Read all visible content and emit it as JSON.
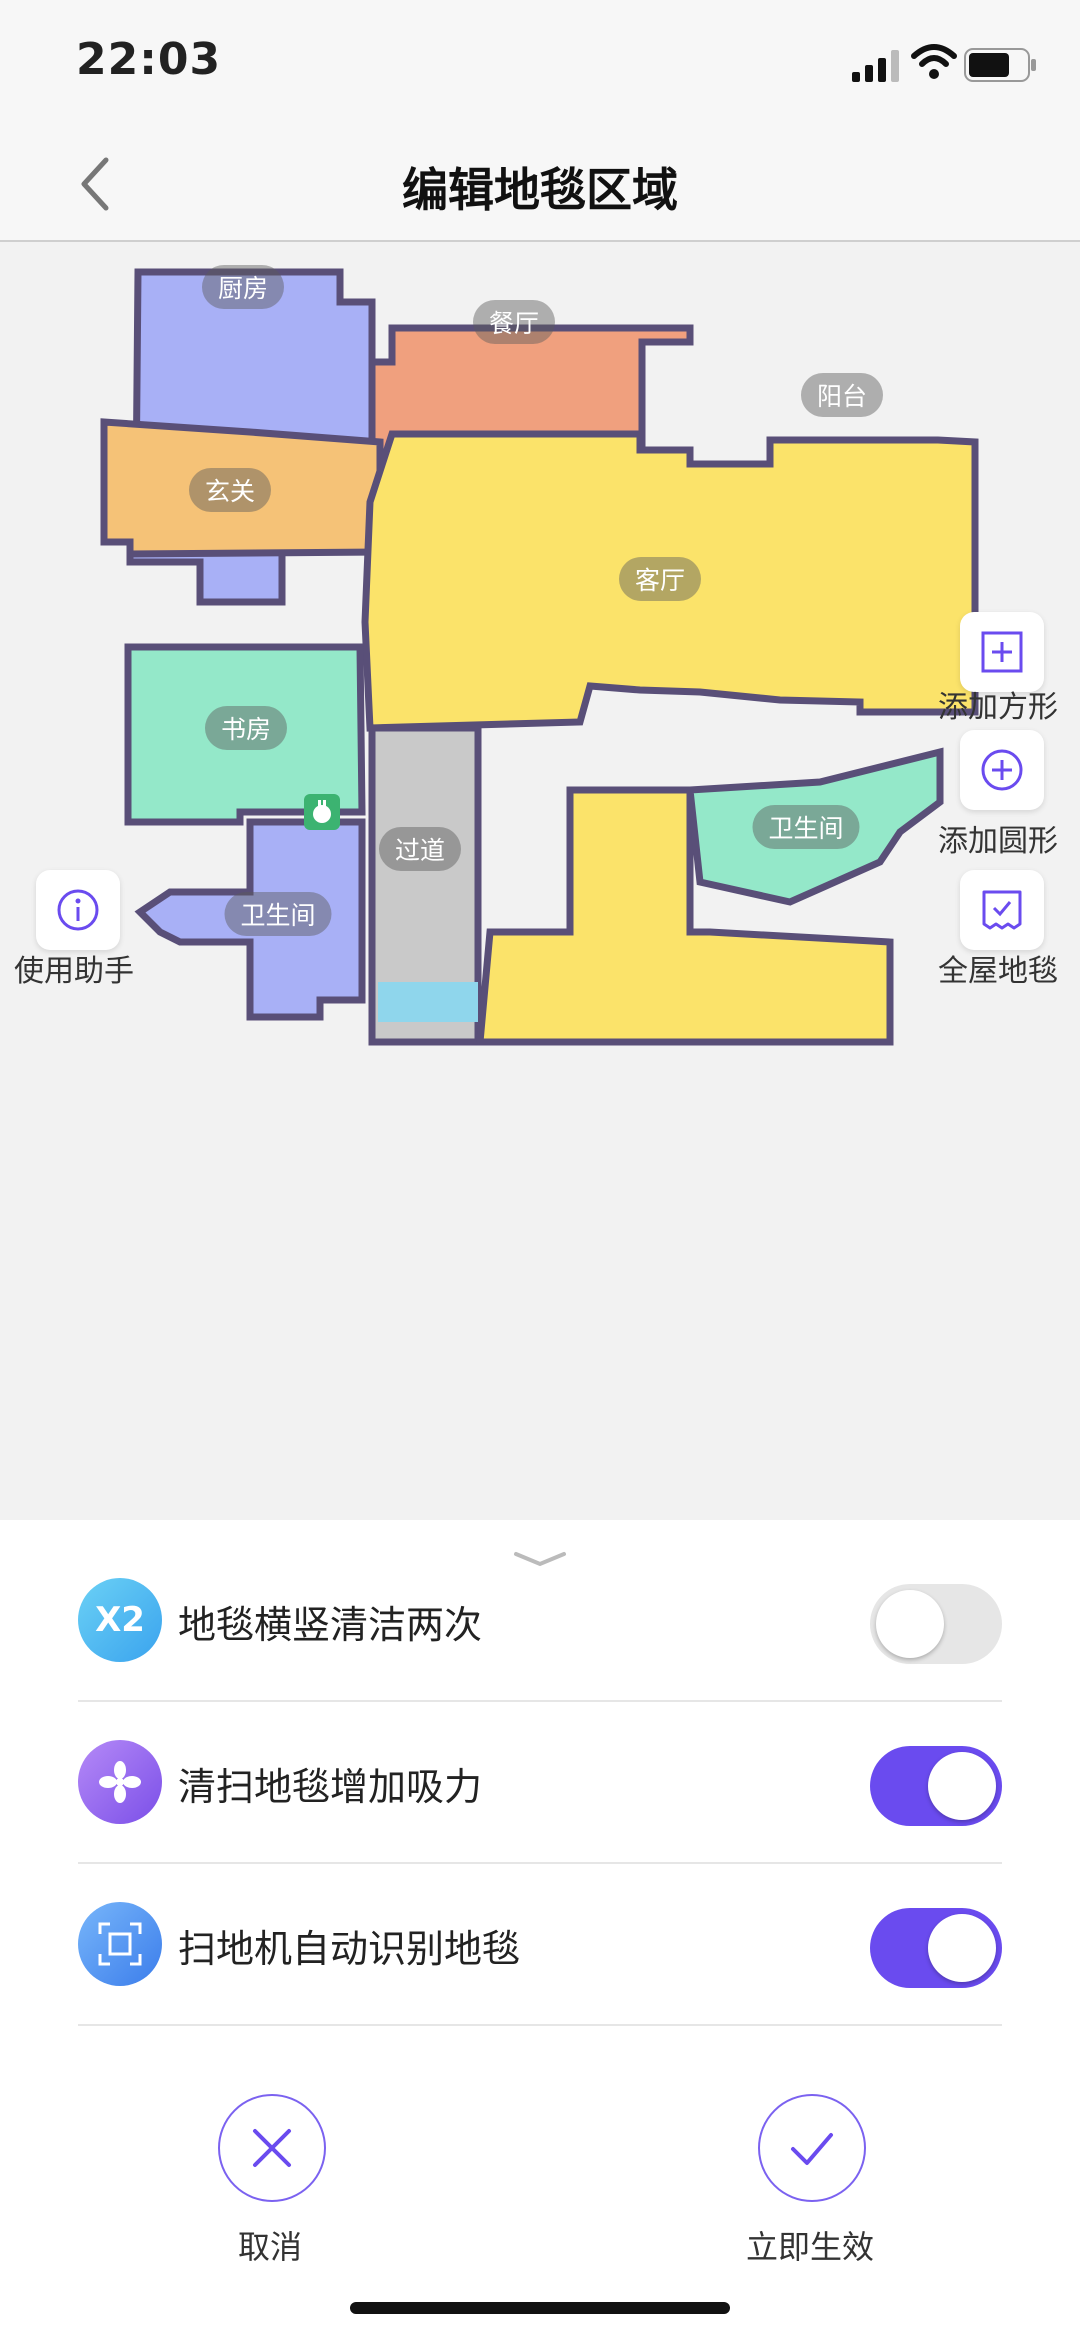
{
  "status_bar": {
    "time": "22:03"
  },
  "nav": {
    "title": "编辑地毯区域",
    "back_icon": "chevron-left-icon"
  },
  "map": {
    "rooms": [
      {
        "id": "kitchen",
        "label": "厨房",
        "color": "#a8b0f6"
      },
      {
        "id": "dining",
        "label": "餐厅",
        "color": "#f0a07e"
      },
      {
        "id": "balcony",
        "label": "阳台",
        "color": "#8fd6ec"
      },
      {
        "id": "entrance",
        "label": "玄关",
        "color": "#f5c277"
      },
      {
        "id": "living",
        "label": "客厅",
        "color": "#fbe36a"
      },
      {
        "id": "study",
        "label": "书房",
        "color": "#94e8c9"
      },
      {
        "id": "corridor",
        "label": "过道",
        "color": "#c9c9c9"
      },
      {
        "id": "bathroom-left",
        "label": "卫生间",
        "color": "#a8b0f6"
      },
      {
        "id": "bathroom-right",
        "label": "卫生间",
        "color": "#94e8c9"
      }
    ],
    "wall_color": "#594f78",
    "dock_icon": "charging-dock-icon"
  },
  "tools": {
    "add_rect": {
      "label": "添加方形",
      "icon": "add-square-icon"
    },
    "add_circle": {
      "label": "添加圆形",
      "icon": "add-circle-icon"
    },
    "whole_house": {
      "label": "全屋地毯",
      "icon": "carpet-icon"
    },
    "assistant": {
      "label": "使用助手",
      "icon": "info-icon"
    }
  },
  "options": [
    {
      "label": "地毯横竖清洁两次",
      "icon_text": "X2",
      "icon": "x2-icon",
      "enabled": false
    },
    {
      "label": "清扫地毯增加吸力",
      "icon": "fan-icon",
      "enabled": true
    },
    {
      "label": "扫地机自动识别地毯",
      "icon": "scan-icon",
      "enabled": true
    }
  ],
  "actions": {
    "cancel": "取消",
    "apply": "立即生效"
  },
  "colors": {
    "accent": "#6a4bef",
    "toggle_off": "#e6e6e6"
  }
}
